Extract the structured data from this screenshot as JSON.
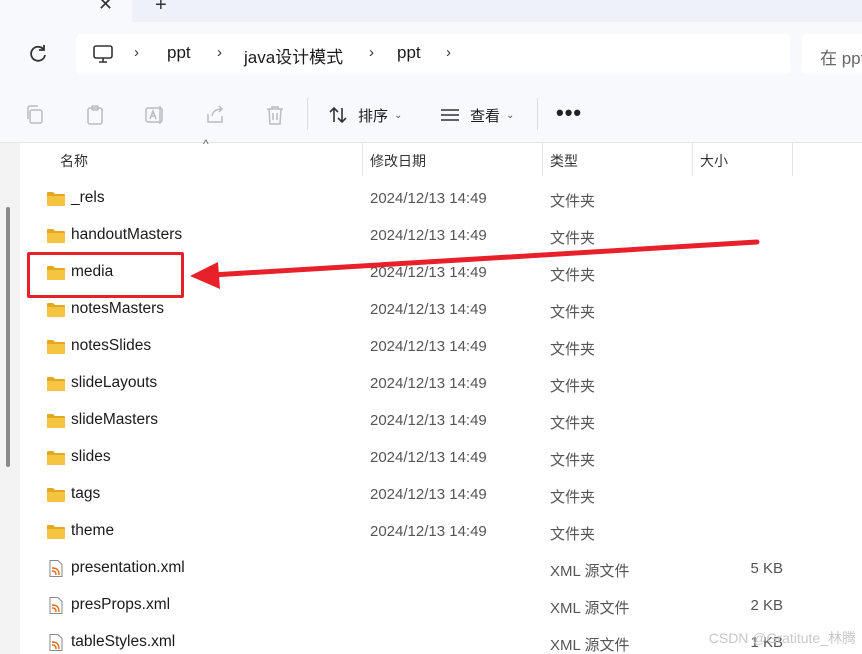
{
  "tabs": {
    "close_glyph": "✕",
    "new_glyph": "+"
  },
  "breadcrumb": {
    "items": [
      "ppt",
      "java设计模式",
      "ppt"
    ],
    "chevron": "›"
  },
  "search": {
    "placeholder": "在 ppt"
  },
  "toolbar": {
    "sort_label": "排序",
    "view_label": "查看",
    "more_label": "•••",
    "dropdown_glyph": "⌄"
  },
  "columns": {
    "name": "名称",
    "modified": "修改日期",
    "type": "类型",
    "size": "大小",
    "sort_glyph": "^"
  },
  "files": [
    {
      "name": "_rels",
      "modified": "2024/12/13 14:49",
      "type": "文件夹",
      "size": "",
      "kind": "folder"
    },
    {
      "name": "handoutMasters",
      "modified": "2024/12/13 14:49",
      "type": "文件夹",
      "size": "",
      "kind": "folder"
    },
    {
      "name": "media",
      "modified": "2024/12/13 14:49",
      "type": "文件夹",
      "size": "",
      "kind": "folder"
    },
    {
      "name": "notesMasters",
      "modified": "2024/12/13 14:49",
      "type": "文件夹",
      "size": "",
      "kind": "folder"
    },
    {
      "name": "notesSlides",
      "modified": "2024/12/13 14:49",
      "type": "文件夹",
      "size": "",
      "kind": "folder"
    },
    {
      "name": "slideLayouts",
      "modified": "2024/12/13 14:49",
      "type": "文件夹",
      "size": "",
      "kind": "folder"
    },
    {
      "name": "slideMasters",
      "modified": "2024/12/13 14:49",
      "type": "文件夹",
      "size": "",
      "kind": "folder"
    },
    {
      "name": "slides",
      "modified": "2024/12/13 14:49",
      "type": "文件夹",
      "size": "",
      "kind": "folder"
    },
    {
      "name": "tags",
      "modified": "2024/12/13 14:49",
      "type": "文件夹",
      "size": "",
      "kind": "folder"
    },
    {
      "name": "theme",
      "modified": "2024/12/13 14:49",
      "type": "文件夹",
      "size": "",
      "kind": "folder"
    },
    {
      "name": "presentation.xml",
      "modified": "",
      "type": "XML 源文件",
      "size": "5 KB",
      "kind": "xml"
    },
    {
      "name": "presProps.xml",
      "modified": "",
      "type": "XML 源文件",
      "size": "2 KB",
      "kind": "xml"
    },
    {
      "name": "tableStyles.xml",
      "modified": "",
      "type": "XML 源文件",
      "size": "1 KB",
      "kind": "xml"
    }
  ],
  "annotation": {
    "highlighted_item": "media",
    "color": "#e8202a"
  },
  "watermark": "CSDN @Gratitute_林腾",
  "colors": {
    "folder": "#f5c542",
    "folder_dark": "#e2a91f",
    "accent": "#e8202a"
  }
}
